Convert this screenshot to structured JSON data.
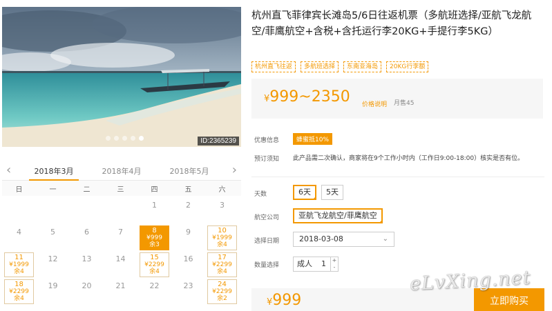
{
  "hero": {
    "image_id": "ID:2365239",
    "dots": 5,
    "active_dot": 4
  },
  "calendar": {
    "tabs": [
      "2018年3月",
      "2018年4月",
      "2018年5月"
    ],
    "weekdays": [
      "日",
      "一",
      "二",
      "三",
      "四",
      "五",
      "六"
    ],
    "cells": [
      {
        "d": "1",
        "r": 0,
        "c": 4
      },
      {
        "d": "2",
        "r": 0,
        "c": 5
      },
      {
        "d": "3",
        "r": 0,
        "c": 6
      },
      {
        "d": "4",
        "r": 1,
        "c": 0
      },
      {
        "d": "5",
        "r": 1,
        "c": 1
      },
      {
        "d": "6",
        "r": 1,
        "c": 2
      },
      {
        "d": "7",
        "r": 1,
        "c": 3
      },
      {
        "d": "8",
        "r": 1,
        "c": 4,
        "p": "¥999",
        "s": "余3",
        "sel": true
      },
      {
        "d": "9",
        "r": 1,
        "c": 5
      },
      {
        "d": "10",
        "r": 1,
        "c": 6,
        "p": "¥1999",
        "s": "余4"
      },
      {
        "d": "11",
        "r": 2,
        "c": 0,
        "p": "¥1999",
        "s": "余4"
      },
      {
        "d": "12",
        "r": 2,
        "c": 1
      },
      {
        "d": "13",
        "r": 2,
        "c": 2
      },
      {
        "d": "14",
        "r": 2,
        "c": 3
      },
      {
        "d": "15",
        "r": 2,
        "c": 4,
        "p": "¥2299",
        "s": "余4"
      },
      {
        "d": "16",
        "r": 2,
        "c": 5
      },
      {
        "d": "17",
        "r": 2,
        "c": 6,
        "p": "¥2299",
        "s": "余4"
      },
      {
        "d": "18",
        "r": 3,
        "c": 0,
        "p": "¥2299",
        "s": "余4"
      },
      {
        "d": "19",
        "r": 3,
        "c": 1
      },
      {
        "d": "20",
        "r": 3,
        "c": 2
      },
      {
        "d": "21",
        "r": 3,
        "c": 3
      },
      {
        "d": "22",
        "r": 3,
        "c": 4
      },
      {
        "d": "23",
        "r": 3,
        "c": 5
      },
      {
        "d": "24",
        "r": 3,
        "c": 6,
        "p": "¥2299",
        "s": "余2"
      }
    ]
  },
  "product": {
    "title": "杭州直飞菲律宾长滩岛5/6日往返机票（多航班选择/亚航飞龙航空/菲鹰航空+含税+含托运行李20KG+手提行李5KG）",
    "tags": [
      "杭州直飞往返",
      "多航班选择",
      "东南亚海岛",
      "20KG行李额"
    ],
    "price_range": "999~2350",
    "currency": "¥",
    "price_explain": "价格说明",
    "sold": "月售45"
  },
  "info": {
    "promo_label": "优惠信息",
    "promo_badge": "蜂蜜抵10%",
    "notice_label": "预订须知",
    "notice_text": "此产品需二次确认，商家将在9个工作小时内（工作日9:00-18:00）核实是否有位。"
  },
  "options": {
    "days_label": "天数",
    "days": [
      "6天",
      "5天"
    ],
    "airline_label": "航空公司",
    "airline": "亚航飞龙航空/菲鹰航空",
    "date_label": "选择日期",
    "date_value": "2018-03-08",
    "qty_label": "数量选择",
    "qty_type": "成人",
    "qty_value": "1"
  },
  "buy": {
    "price": "999",
    "button": "立即购买"
  },
  "watermark": "eLvXing.net"
}
